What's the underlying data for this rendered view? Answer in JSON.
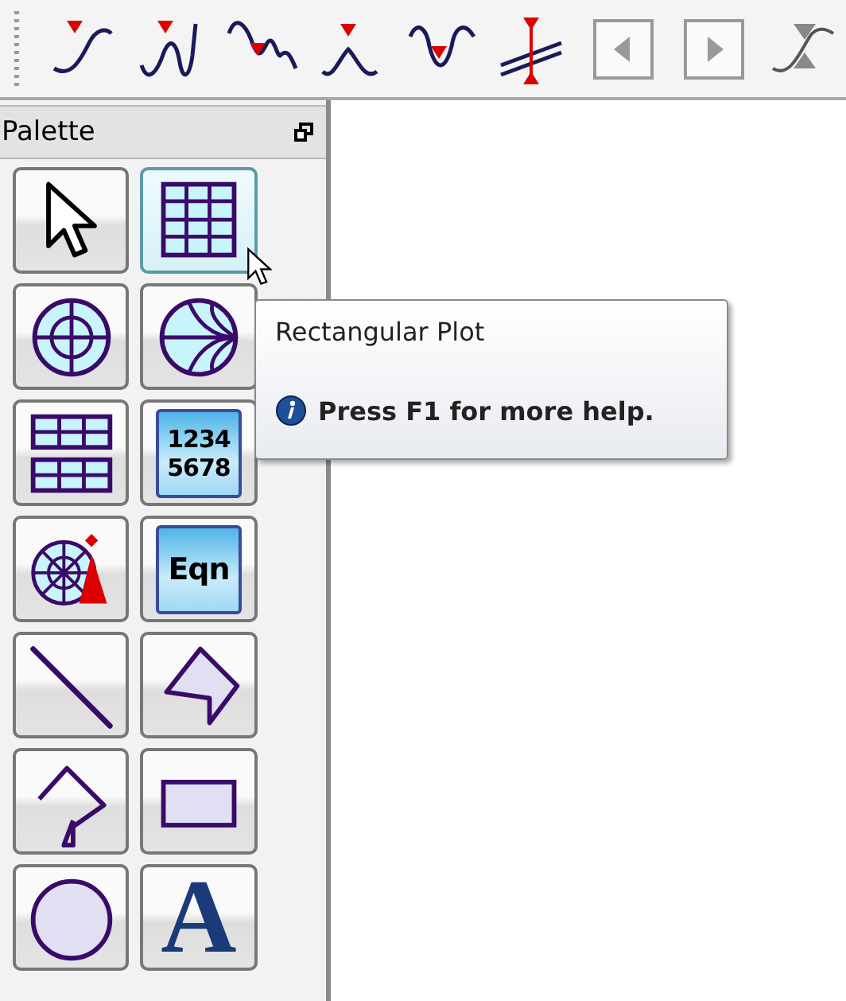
{
  "toolbar": {
    "items": [
      {
        "kind": "marker"
      },
      {
        "kind": "peak-wave"
      },
      {
        "kind": "valley-wave"
      },
      {
        "kind": "peak"
      },
      {
        "kind": "valley"
      },
      {
        "kind": "delta"
      },
      {
        "kind": "left"
      },
      {
        "kind": "right"
      },
      {
        "kind": "swap"
      }
    ]
  },
  "palette": {
    "title": "Palette",
    "items": [
      {
        "kind": "pointer",
        "hovered": false
      },
      {
        "kind": "rect-plot",
        "hovered": true
      },
      {
        "kind": "polar-plot",
        "hovered": false
      },
      {
        "kind": "smith-plot",
        "hovered": false
      },
      {
        "kind": "table",
        "hovered": false
      },
      {
        "kind": "list",
        "lines": [
          "1234",
          "5678"
        ],
        "hovered": false
      },
      {
        "kind": "antenna",
        "hovered": false
      },
      {
        "kind": "equation",
        "text": "Eqn",
        "hovered": false
      },
      {
        "kind": "line",
        "hovered": false
      },
      {
        "kind": "polygon",
        "hovered": false
      },
      {
        "kind": "polyline",
        "hovered": false
      },
      {
        "kind": "rectangle",
        "hovered": false
      },
      {
        "kind": "ellipse",
        "hovered": false
      },
      {
        "kind": "text",
        "text": "A",
        "hovered": false
      }
    ]
  },
  "tooltip": {
    "title": "Rectangular Plot",
    "hint": "Press F1 for more help."
  }
}
